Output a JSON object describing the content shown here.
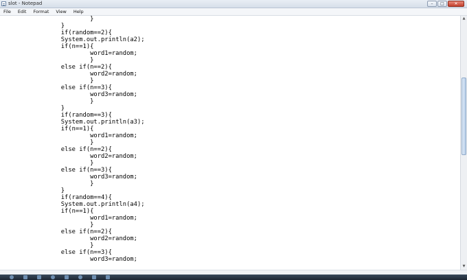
{
  "window": {
    "title": "slot - Notepad"
  },
  "menu": [
    {
      "id": "file",
      "label": "File"
    },
    {
      "id": "edit",
      "label": "Edit"
    },
    {
      "id": "format",
      "label": "Format"
    },
    {
      "id": "view",
      "label": "View"
    },
    {
      "id": "help",
      "label": "Help"
    }
  ],
  "editor": {
    "lines": [
      "\t\t\t}",
      "\t\t}",
      "\t\tif(random==2){",
      "\t\tSystem.out.println(a2);",
      "\t\tif(n==1){",
      "\t\t\tword1=random;",
      "\t\t\t}",
      "\t\telse if(n==2){",
      "\t\t\tword2=random;",
      "\t\t\t}",
      "\t\telse if(n==3){",
      "\t\t\tword3=random;",
      "\t\t\t}",
      "\t\t}",
      "\t\tif(random==3){",
      "\t\tSystem.out.println(a3);",
      "\t\tif(n==1){",
      "\t\t\tword1=random;",
      "\t\t\t}",
      "\t\telse if(n==2){",
      "\t\t\tword2=random;",
      "\t\t\t}",
      "\t\telse if(n==3){",
      "\t\t\tword3=random;",
      "\t\t\t}",
      "\t\t}",
      "\t\tif(random==4){",
      "\t\tSystem.out.println(a4);",
      "\t\tif(n==1){",
      "\t\t\tword1=random;",
      "\t\t\t}",
      "\t\telse if(n==2){",
      "\t\t\tword2=random;",
      "\t\t\t}",
      "\t\telse if(n==3){",
      "\t\t\tword3=random;"
    ]
  },
  "scrollbar": {
    "vertical_position": 0.34,
    "vertical_visible_fraction": 0.32
  },
  "colors": {
    "titlebar": "#dfe6ef",
    "close_button": "#c84a36",
    "scroll_thumb": "#b9cfe9",
    "taskbar": "#1c2633"
  }
}
